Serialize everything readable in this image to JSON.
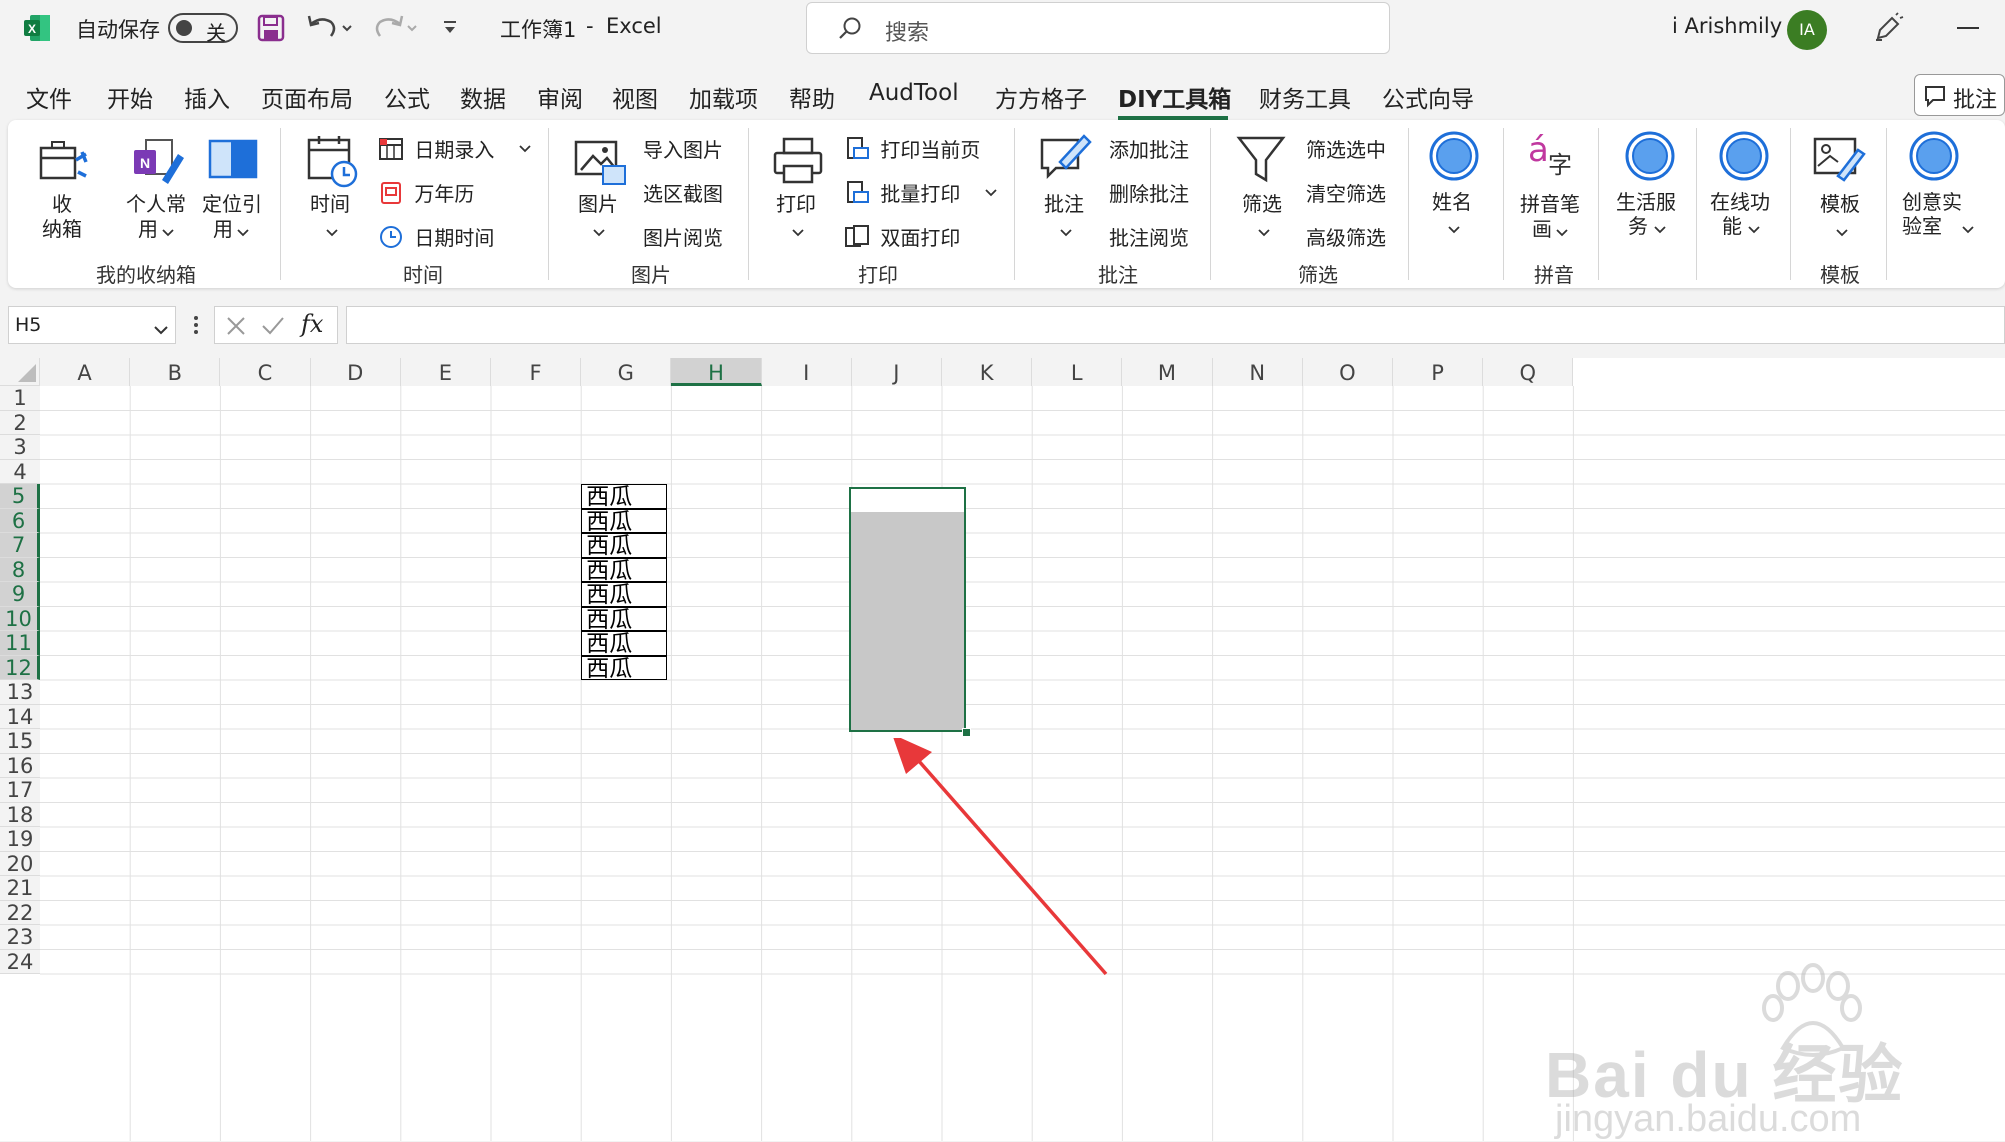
{
  "titlebar": {
    "autosave_label": "自动保存",
    "autosave_state": "关",
    "doc_title": "工作簿1",
    "separator": "-",
    "app_name": "Excel",
    "search_placeholder": "搜索",
    "user_name": "i Arishmily",
    "user_initials": "IA"
  },
  "menu": {
    "tabs": [
      "文件",
      "开始",
      "插入",
      "页面布局",
      "公式",
      "数据",
      "审阅",
      "视图",
      "加载项",
      "帮助",
      "AudTool",
      "方方格子",
      "DIY工具箱",
      "财务工具",
      "公式向导"
    ],
    "active_tab": "DIY工具箱",
    "comment_button": "批注"
  },
  "ribbon": {
    "storage": {
      "group": "我的收纳箱",
      "btn1": [
        "收",
        "纳箱"
      ],
      "btn2": [
        "个人常",
        "用"
      ],
      "btn3": [
        "定位引",
        "用"
      ]
    },
    "time": {
      "group": "时间",
      "big": "时间",
      "items": [
        "日期录入",
        "万年历",
        "日期时间"
      ]
    },
    "picture": {
      "group": "图片",
      "big": "图片",
      "items": [
        "导入图片",
        "选区截图",
        "图片阅览"
      ]
    },
    "print": {
      "group": "打印",
      "big": "打印",
      "items": [
        "打印当前页",
        "批量打印",
        "双面打印"
      ]
    },
    "comment": {
      "group": "批注",
      "big": "批注",
      "items": [
        "添加批注",
        "删除批注",
        "批注阅览"
      ]
    },
    "filter": {
      "group": "筛选",
      "big": "筛选",
      "items": [
        "筛选选中",
        "清空筛选",
        "高级筛选"
      ]
    },
    "name": {
      "big": "姓名"
    },
    "pinyin": {
      "group": "拼音",
      "big": [
        "拼音笔",
        "画"
      ],
      "icon_a": "á",
      "icon_zi": "字"
    },
    "life": {
      "big": [
        "生活服",
        "务"
      ]
    },
    "online": {
      "big": [
        "在线功",
        "能"
      ]
    },
    "template": {
      "group": "模板",
      "big": "模板"
    },
    "lab": {
      "big": [
        "创意实",
        "验室"
      ]
    }
  },
  "formula_bar": {
    "name_box": "H5",
    "fx": "fx",
    "value": ""
  },
  "grid": {
    "columns": [
      "A",
      "B",
      "C",
      "D",
      "E",
      "F",
      "G",
      "H",
      "I",
      "J",
      "K",
      "L",
      "M",
      "N",
      "O",
      "P",
      "Q"
    ],
    "rows": [
      "1",
      "2",
      "3",
      "4",
      "5",
      "6",
      "7",
      "8",
      "9",
      "10",
      "11",
      "12",
      "13",
      "14",
      "15",
      "16",
      "17",
      "18",
      "19",
      "20",
      "21",
      "22",
      "23",
      "24"
    ],
    "selected_column": "H",
    "selected_rows": [
      "5",
      "6",
      "7",
      "8",
      "9",
      "10",
      "11",
      "12"
    ],
    "active_cell": "H5",
    "g_values": [
      "西瓜",
      "西瓜",
      "西瓜",
      "西瓜",
      "西瓜",
      "西瓜",
      "西瓜",
      "西瓜"
    ]
  },
  "colors": {
    "excel_green": "#1e7145",
    "selection_fill": "#c8c8c8",
    "arrow_red": "#e8383a",
    "avatar_green": "#3b7d23",
    "ribbon_blue": "#1e6fd9"
  },
  "watermark": {
    "brand": "Bai du 经验",
    "url": "jingyan.baidu.com"
  }
}
